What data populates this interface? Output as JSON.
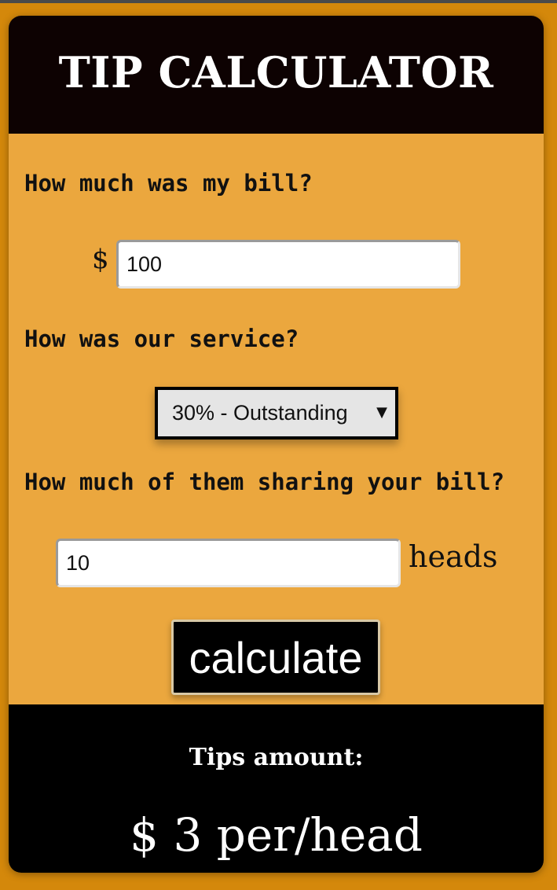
{
  "app": {
    "title": "TIP CALCULATOR"
  },
  "bill": {
    "question": "How much was my bill?",
    "currency_symbol": "$",
    "value": "100"
  },
  "service": {
    "question": "How was our service?",
    "selected": "30% - Outstanding",
    "arrow_icon": "triangle-down-icon"
  },
  "people": {
    "question": "How much of them sharing your bill?",
    "value": "10",
    "unit": "heads"
  },
  "actions": {
    "calculate_label": "calculate"
  },
  "result": {
    "title": "Tips amount:",
    "amount": "$ 3 per/head"
  },
  "colors": {
    "page_background": "#d4880b",
    "card_background": "#eba73e",
    "header_background": "#0d0202",
    "results_background": "#000000",
    "button_background": "#000000"
  }
}
